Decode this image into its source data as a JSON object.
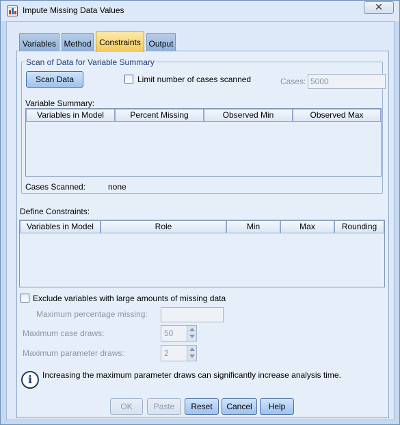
{
  "window": {
    "title": "Impute Missing Data Values",
    "close_glyph": "✕"
  },
  "tabs": [
    {
      "label": "Variables",
      "active": false
    },
    {
      "label": "Method",
      "active": false
    },
    {
      "label": "Constraints",
      "active": true
    },
    {
      "label": "Output",
      "active": false
    }
  ],
  "scan_group": {
    "legend": "Scan of Data for Variable Summary",
    "scan_button": "Scan Data",
    "limit_checkbox_label": "Limit number of cases scanned",
    "limit_checked": false,
    "cases_label": "Cases:",
    "cases_value": "5000",
    "variable_summary_label": "Variable Summary:",
    "summary_columns": [
      "Variables in Model",
      "Percent Missing",
      "Observed Min",
      "Observed Max"
    ],
    "summary_rows": [],
    "cases_scanned_label": "Cases Scanned:",
    "cases_scanned_value": "none"
  },
  "constraints": {
    "label": "Define Constraints:",
    "columns": [
      "Variables in Model",
      "Role",
      "Min",
      "Max",
      "Rounding"
    ],
    "rows": []
  },
  "exclude": {
    "checkbox_label": "Exclude variables with large amounts of missing data",
    "checked": false,
    "max_pct_label": "Maximum percentage missing:",
    "max_pct_value": ""
  },
  "draws": {
    "case_label": "Maximum case draws:",
    "case_value": "50",
    "param_label": "Maximum parameter draws:",
    "param_value": "2"
  },
  "info": {
    "icon": "info-icon",
    "text": "Increasing the maximum parameter draws can significantly increase analysis time."
  },
  "buttons": {
    "ok": "OK",
    "paste": "Paste",
    "reset": "Reset",
    "cancel": "Cancel",
    "help": "Help"
  },
  "colors": {
    "active_tab": "#f5c95a",
    "panel_bg": "#e6eef9",
    "legend_text": "#1f3d7a"
  }
}
